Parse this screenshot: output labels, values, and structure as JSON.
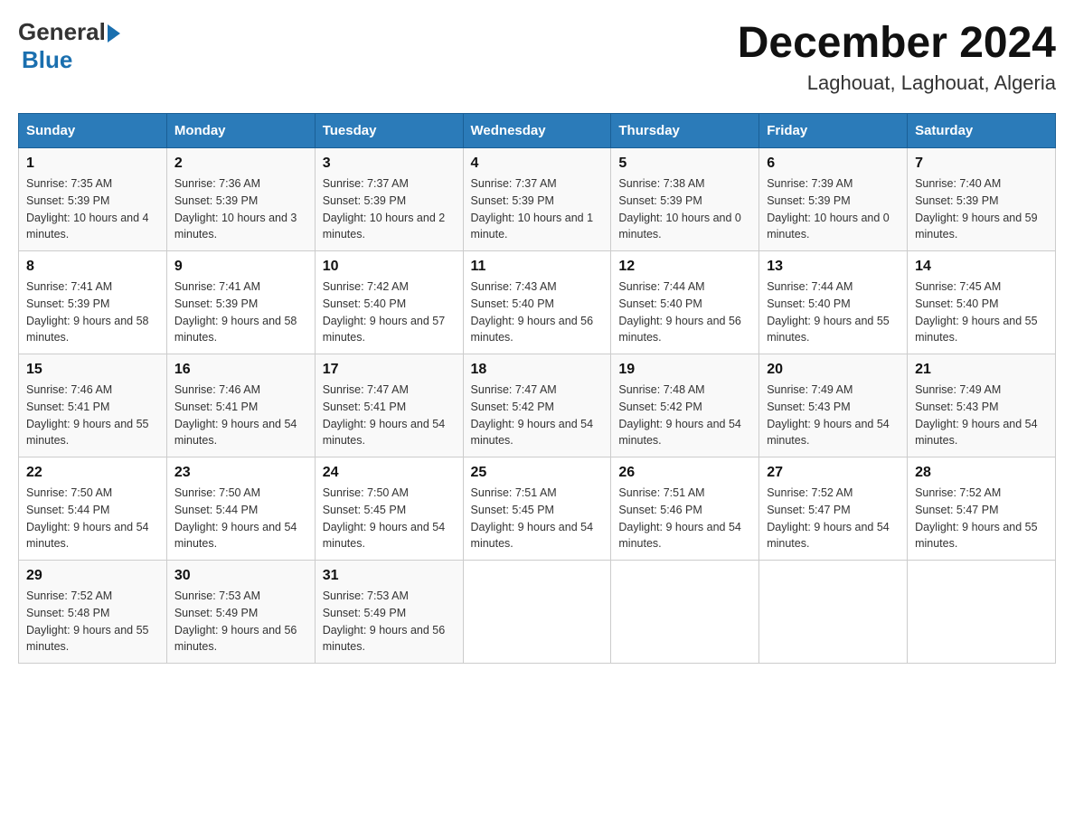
{
  "header": {
    "logo_general": "General",
    "logo_blue": "Blue",
    "title": "December 2024",
    "subtitle": "Laghouat, Laghouat, Algeria"
  },
  "days_of_week": [
    "Sunday",
    "Monday",
    "Tuesday",
    "Wednesday",
    "Thursday",
    "Friday",
    "Saturday"
  ],
  "weeks": [
    [
      {
        "day": "1",
        "sunrise": "7:35 AM",
        "sunset": "5:39 PM",
        "daylight": "10 hours and 4 minutes."
      },
      {
        "day": "2",
        "sunrise": "7:36 AM",
        "sunset": "5:39 PM",
        "daylight": "10 hours and 3 minutes."
      },
      {
        "day": "3",
        "sunrise": "7:37 AM",
        "sunset": "5:39 PM",
        "daylight": "10 hours and 2 minutes."
      },
      {
        "day": "4",
        "sunrise": "7:37 AM",
        "sunset": "5:39 PM",
        "daylight": "10 hours and 1 minute."
      },
      {
        "day": "5",
        "sunrise": "7:38 AM",
        "sunset": "5:39 PM",
        "daylight": "10 hours and 0 minutes."
      },
      {
        "day": "6",
        "sunrise": "7:39 AM",
        "sunset": "5:39 PM",
        "daylight": "10 hours and 0 minutes."
      },
      {
        "day": "7",
        "sunrise": "7:40 AM",
        "sunset": "5:39 PM",
        "daylight": "9 hours and 59 minutes."
      }
    ],
    [
      {
        "day": "8",
        "sunrise": "7:41 AM",
        "sunset": "5:39 PM",
        "daylight": "9 hours and 58 minutes."
      },
      {
        "day": "9",
        "sunrise": "7:41 AM",
        "sunset": "5:39 PM",
        "daylight": "9 hours and 58 minutes."
      },
      {
        "day": "10",
        "sunrise": "7:42 AM",
        "sunset": "5:40 PM",
        "daylight": "9 hours and 57 minutes."
      },
      {
        "day": "11",
        "sunrise": "7:43 AM",
        "sunset": "5:40 PM",
        "daylight": "9 hours and 56 minutes."
      },
      {
        "day": "12",
        "sunrise": "7:44 AM",
        "sunset": "5:40 PM",
        "daylight": "9 hours and 56 minutes."
      },
      {
        "day": "13",
        "sunrise": "7:44 AM",
        "sunset": "5:40 PM",
        "daylight": "9 hours and 55 minutes."
      },
      {
        "day": "14",
        "sunrise": "7:45 AM",
        "sunset": "5:40 PM",
        "daylight": "9 hours and 55 minutes."
      }
    ],
    [
      {
        "day": "15",
        "sunrise": "7:46 AM",
        "sunset": "5:41 PM",
        "daylight": "9 hours and 55 minutes."
      },
      {
        "day": "16",
        "sunrise": "7:46 AM",
        "sunset": "5:41 PM",
        "daylight": "9 hours and 54 minutes."
      },
      {
        "day": "17",
        "sunrise": "7:47 AM",
        "sunset": "5:41 PM",
        "daylight": "9 hours and 54 minutes."
      },
      {
        "day": "18",
        "sunrise": "7:47 AM",
        "sunset": "5:42 PM",
        "daylight": "9 hours and 54 minutes."
      },
      {
        "day": "19",
        "sunrise": "7:48 AM",
        "sunset": "5:42 PM",
        "daylight": "9 hours and 54 minutes."
      },
      {
        "day": "20",
        "sunrise": "7:49 AM",
        "sunset": "5:43 PM",
        "daylight": "9 hours and 54 minutes."
      },
      {
        "day": "21",
        "sunrise": "7:49 AM",
        "sunset": "5:43 PM",
        "daylight": "9 hours and 54 minutes."
      }
    ],
    [
      {
        "day": "22",
        "sunrise": "7:50 AM",
        "sunset": "5:44 PM",
        "daylight": "9 hours and 54 minutes."
      },
      {
        "day": "23",
        "sunrise": "7:50 AM",
        "sunset": "5:44 PM",
        "daylight": "9 hours and 54 minutes."
      },
      {
        "day": "24",
        "sunrise": "7:50 AM",
        "sunset": "5:45 PM",
        "daylight": "9 hours and 54 minutes."
      },
      {
        "day": "25",
        "sunrise": "7:51 AM",
        "sunset": "5:45 PM",
        "daylight": "9 hours and 54 minutes."
      },
      {
        "day": "26",
        "sunrise": "7:51 AM",
        "sunset": "5:46 PM",
        "daylight": "9 hours and 54 minutes."
      },
      {
        "day": "27",
        "sunrise": "7:52 AM",
        "sunset": "5:47 PM",
        "daylight": "9 hours and 54 minutes."
      },
      {
        "day": "28",
        "sunrise": "7:52 AM",
        "sunset": "5:47 PM",
        "daylight": "9 hours and 55 minutes."
      }
    ],
    [
      {
        "day": "29",
        "sunrise": "7:52 AM",
        "sunset": "5:48 PM",
        "daylight": "9 hours and 55 minutes."
      },
      {
        "day": "30",
        "sunrise": "7:53 AM",
        "sunset": "5:49 PM",
        "daylight": "9 hours and 56 minutes."
      },
      {
        "day": "31",
        "sunrise": "7:53 AM",
        "sunset": "5:49 PM",
        "daylight": "9 hours and 56 minutes."
      },
      null,
      null,
      null,
      null
    ]
  ],
  "labels": {
    "sunrise": "Sunrise:",
    "sunset": "Sunset:",
    "daylight": "Daylight:"
  }
}
